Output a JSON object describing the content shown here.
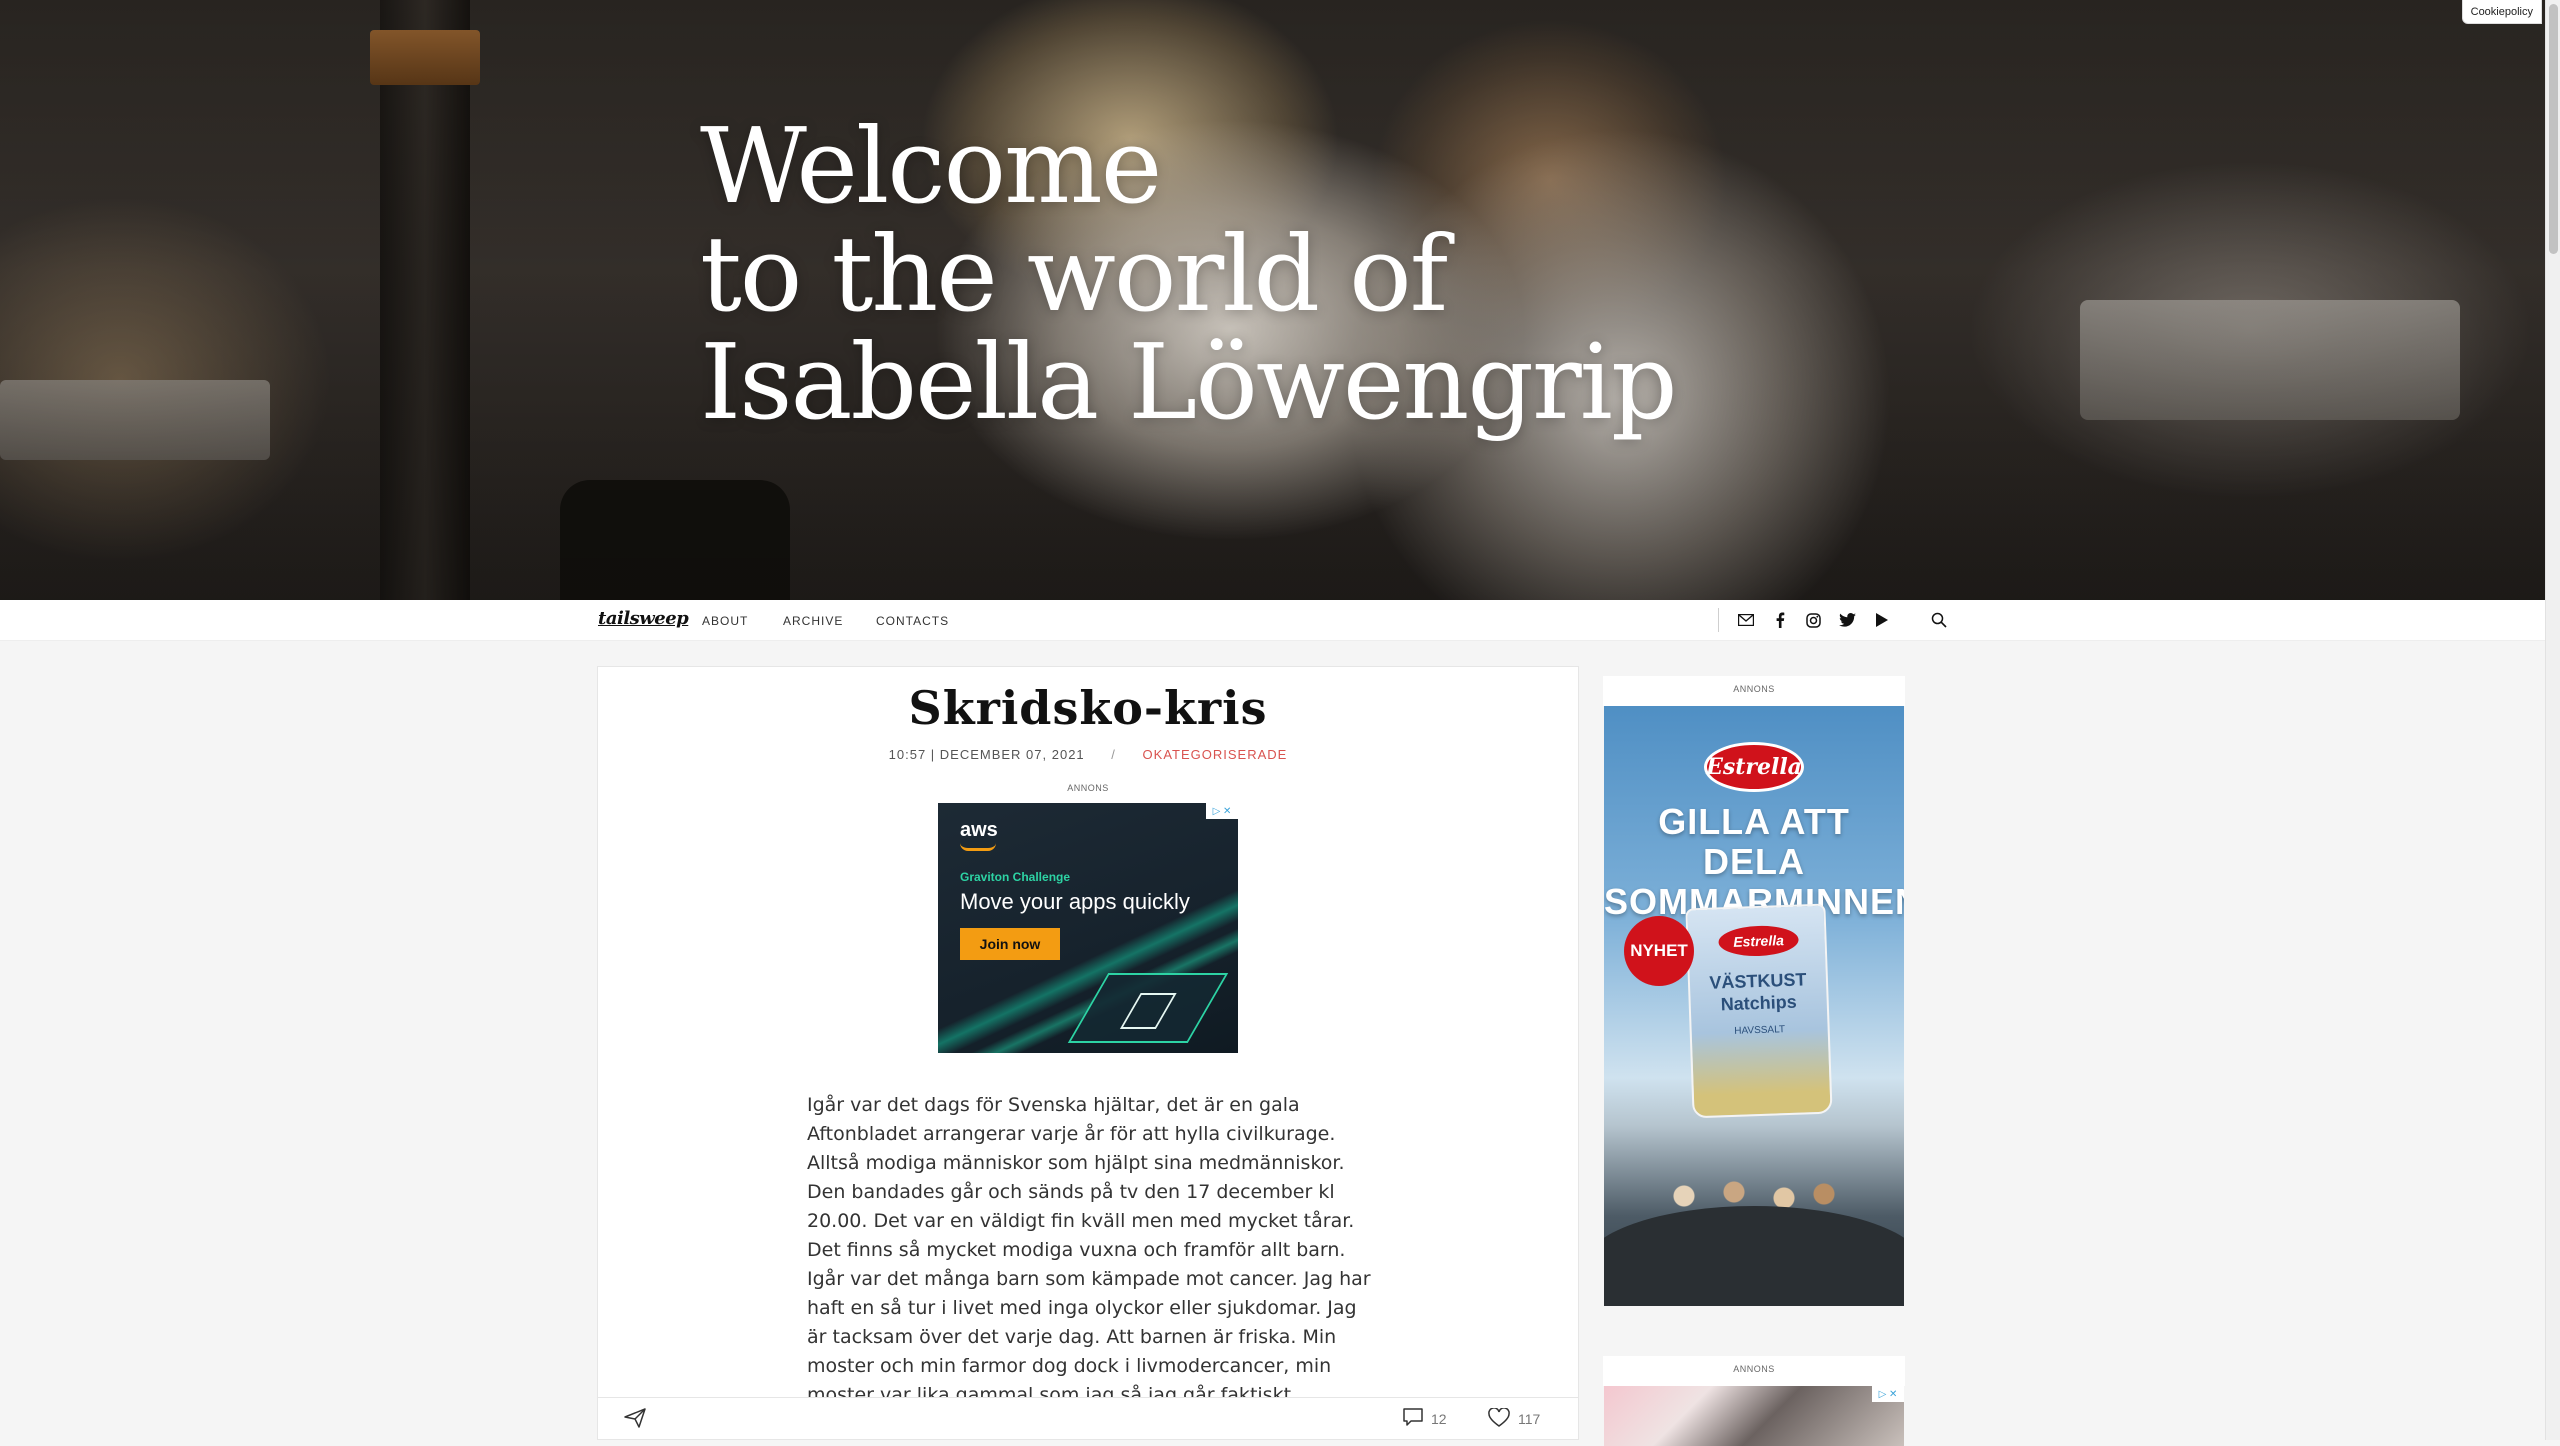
{
  "hero": {
    "line1": "Welcome",
    "line2": "to the world of",
    "line3": "Isabella Löwengrip"
  },
  "cookie": {
    "label": "Cookiepolicy"
  },
  "nav": {
    "brand": "tailsweep",
    "links": [
      "ABOUT",
      "ARCHIVE",
      "CONTACTS"
    ],
    "icons": [
      "mail-icon",
      "facebook-icon",
      "instagram-icon",
      "twitter-icon",
      "youtube-icon",
      "search-icon"
    ]
  },
  "post": {
    "title": "Skridsko-kris",
    "time_date": "10:57 | DECEMBER 07, 2021",
    "separator": "/",
    "category": "OKATEGORISERADE",
    "ad_label": "ANNONS",
    "body": "Igår var det dags för Svenska hjältar, det är en gala Aftonbladet arrangerar varje år för att hylla civilkurage. Alltså modiga människor som hjälpt sina medmänniskor. Den bandades går och sänds på tv den 17 december kl 20.00. Det var en väldigt fin kväll men med mycket tårar. Det finns så mycket modiga vuxna och framför allt barn. Igår var det många barn som kämpade mot cancer. Jag har haft en så tur i livet med inga olyckor eller sjukdomar. Jag är tacksam över det varje dag. Att barnen är friska. Min moster och min farmor dog dock i livmodercancer, min moster var lika gammal som jag så jag går faktiskt regelbundet och kikar så att det inte är något. Jag var",
    "comments_count": "12",
    "likes_count": "117"
  },
  "aws_ad": {
    "logo": "aws",
    "kicker": "Graviton Challenge",
    "headline": "Move your apps quickly",
    "cta": "Join now",
    "adchoice": "▷ ✕"
  },
  "sidebar": {
    "ad1_label": "ANNONS",
    "ad2_label": "ANNONS",
    "estrella": {
      "brand": "Estrella",
      "headline_1": "GILLA ATT DELA",
      "headline_2": "SOMMARMINNEN",
      "badge": "NYHET",
      "bag_brand": "Estrella",
      "bag_name_1": "VÄSTKUST",
      "bag_name_2": "Natchips",
      "bag_flavor": "HAVSSALT"
    },
    "adchoice": "▷ ✕"
  },
  "colors": {
    "accent": "#d9534f",
    "estrella_red": "#d0121b",
    "aws_orange": "#f39c12",
    "aws_teal": "#2dd3a4"
  }
}
